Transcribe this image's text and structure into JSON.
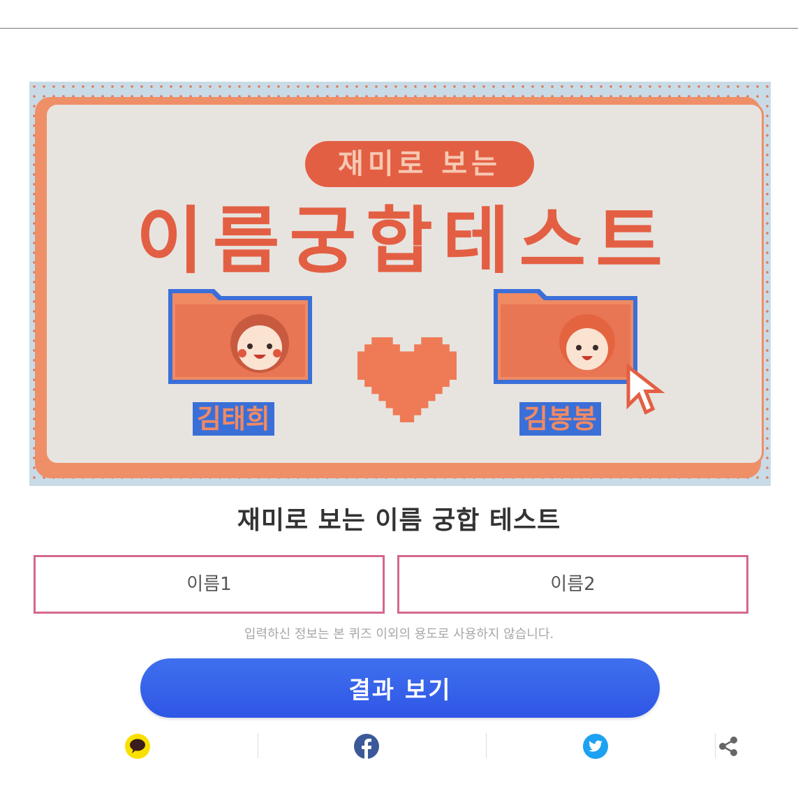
{
  "banner": {
    "pill_text": "재미로 보는",
    "title": "이름궁합테스트",
    "left_name": "김태희",
    "right_name": "김봉봉"
  },
  "quiz_title": "재미로 보는 이름 궁합 테스트",
  "inputs": {
    "name1_placeholder": "이름1",
    "name2_placeholder": "이름2"
  },
  "notice": "입력하신 정보는 본 퀴즈 이외의 용도로 사용하지 않습니다.",
  "result_button": "결과 보기",
  "share": [
    "kakaotalk-icon",
    "facebook-icon",
    "twitter-icon",
    "share-icon"
  ],
  "colors": {
    "accent_orange": "#e35f43",
    "input_border": "#d4678f",
    "button_blue": "#3f70ee",
    "tag_blue": "#3b6fd8"
  }
}
